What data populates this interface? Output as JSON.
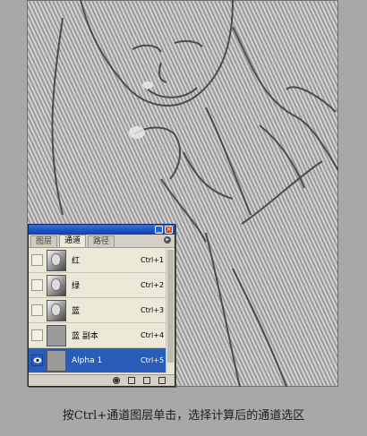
{
  "palette": {
    "tabs": [
      "图层",
      "通道",
      "路径"
    ],
    "active_tab": "通道",
    "channels": [
      {
        "name": "红",
        "shortcut": "Ctrl+1",
        "visible": false,
        "selected": false
      },
      {
        "name": "绿",
        "shortcut": "Ctrl+2",
        "visible": false,
        "selected": false
      },
      {
        "name": "蓝",
        "shortcut": "Ctrl+3",
        "visible": false,
        "selected": false
      },
      {
        "name": "蓝 副本",
        "shortcut": "Ctrl+4",
        "visible": false,
        "selected": false
      },
      {
        "name": "Alpha 1",
        "shortcut": "Ctrl+5",
        "visible": true,
        "selected": true
      }
    ]
  },
  "caption": "按Ctrl+通道图层单击，选择计算后的通道选区",
  "colors": {
    "selection": "#2a5db8",
    "titlebar": "#0a3fb0",
    "background": "#a6a9a8"
  }
}
